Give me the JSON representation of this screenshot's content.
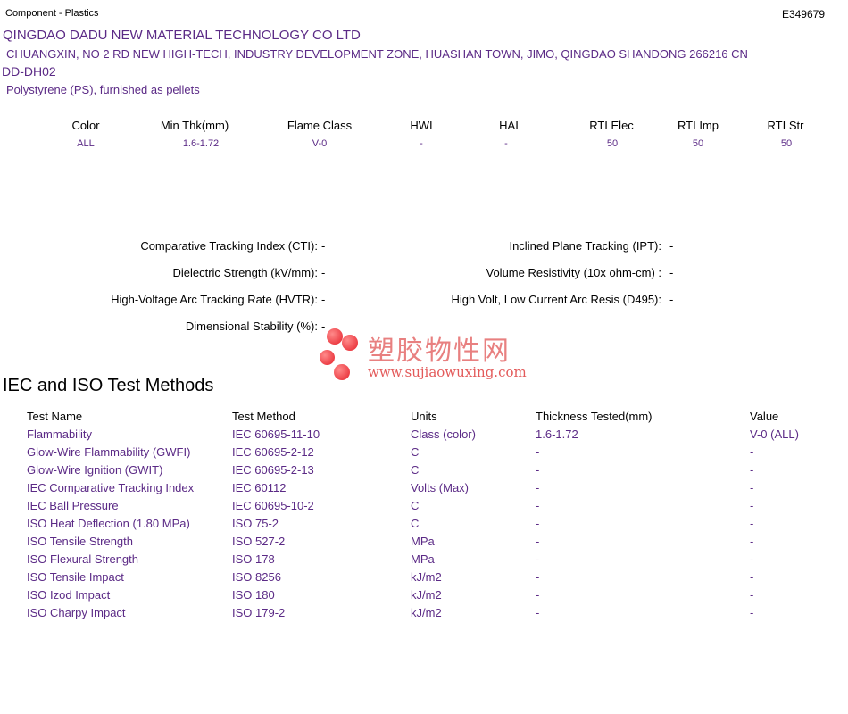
{
  "header": {
    "category": "Component - Plastics",
    "file_number": "E349679"
  },
  "company": {
    "name": "QINGDAO DADU NEW MATERIAL TECHNOLOGY CO LTD",
    "address": "CHUANGXIN, NO 2 RD NEW HIGH-TECH, INDUSTRY DEVELOPMENT ZONE, HUASHAN TOWN, JIMO, QINGDAO  SHANDONG  266216 CN"
  },
  "product": {
    "model": "DD-DH02",
    "description": "Polystyrene (PS), furnished as pellets"
  },
  "ratings": {
    "headers": [
      "Color",
      "Min Thk(mm)",
      "Flame Class",
      "HWI",
      "HAI",
      "RTI Elec",
      "RTI Imp",
      "RTI Str"
    ],
    "values": [
      "ALL",
      "1.6-1.72",
      "V-0",
      "-",
      "-",
      "50",
      "50",
      "50"
    ]
  },
  "properties": {
    "left": [
      {
        "label": "Comparative Tracking Index (CTI):",
        "value": "-"
      },
      {
        "label": "Dielectric Strength (kV/mm):",
        "value": "-"
      },
      {
        "label": "High-Voltage Arc Tracking Rate (HVTR):",
        "value": "-"
      },
      {
        "label": "Dimensional Stability (%):",
        "value": "-"
      }
    ],
    "right": [
      {
        "label": "Inclined Plane Tracking (IPT):",
        "value": "-"
      },
      {
        "label": "Volume Resistivity (10x ohm-cm) :",
        "value": "-"
      },
      {
        "label": "High Volt, Low Current Arc Resis (D495):",
        "value": "-"
      }
    ]
  },
  "watermark": {
    "chinese": "塑胶物性网",
    "url": "www.sujiaowuxing.com"
  },
  "test_methods": {
    "title": "IEC and ISO Test Methods",
    "columns": [
      "Test Name",
      "Test Method",
      "Units",
      "Thickness Tested(mm)",
      "Value"
    ],
    "rows": [
      [
        "Flammability",
        "IEC 60695-11-10",
        "Class (color)",
        "1.6-1.72",
        "V-0 (ALL)"
      ],
      [
        "Glow-Wire Flammability (GWFI)",
        "IEC 60695-2-12",
        "C",
        "-",
        "-"
      ],
      [
        "Glow-Wire Ignition (GWIT)",
        "IEC 60695-2-13",
        "C",
        "-",
        "-"
      ],
      [
        "IEC Comparative Tracking Index",
        "IEC 60112",
        "Volts (Max)",
        "-",
        "-"
      ],
      [
        "IEC Ball Pressure",
        "IEC 60695-10-2",
        "C",
        "-",
        "-"
      ],
      [
        "ISO Heat Deflection (1.80 MPa)",
        "ISO 75-2",
        "C",
        "-",
        "-"
      ],
      [
        "ISO Tensile Strength",
        "ISO 527-2",
        "MPa",
        "-",
        "-"
      ],
      [
        "ISO Flexural Strength",
        "ISO 178",
        "MPa",
        "-",
        "-"
      ],
      [
        "ISO Tensile Impact",
        "ISO 8256",
        "kJ/m2",
        "-",
        "-"
      ],
      [
        "ISO Izod Impact",
        "ISO 180",
        "kJ/m2",
        "-",
        "-"
      ],
      [
        "ISO Charpy Impact",
        "ISO 179-2",
        "kJ/m2",
        "-",
        "-"
      ]
    ]
  },
  "colors": {
    "accent_text": "#5b2a86",
    "watermark": "#e5202a"
  }
}
